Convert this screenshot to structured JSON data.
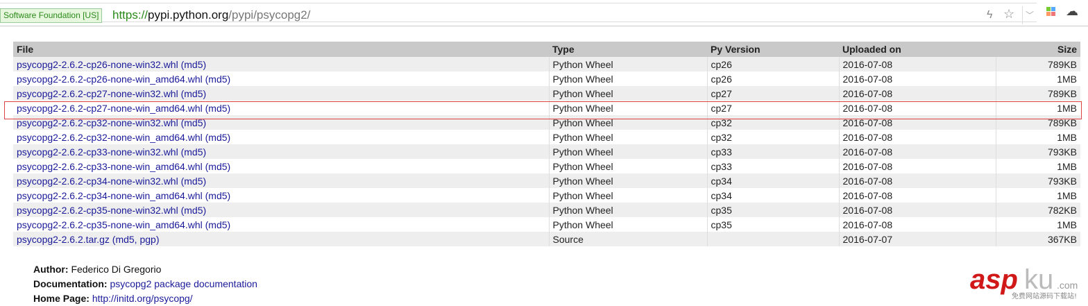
{
  "browser": {
    "cert": "Software Foundation [US]",
    "url_scheme": "https://",
    "url_host": "pypi.python.org",
    "url_path": "/pypi/psycopg2/"
  },
  "table": {
    "headers": [
      "File",
      "Type",
      "Py Version",
      "Uploaded on",
      "Size"
    ],
    "rows": [
      {
        "file": "psycopg2-2.6.2-cp26-none-win32.whl",
        "links": "md5",
        "type": "Python Wheel",
        "py": "cp26",
        "date": "2016-07-08",
        "size": "789KB"
      },
      {
        "file": "psycopg2-2.6.2-cp26-none-win_amd64.whl",
        "links": "md5",
        "type": "Python Wheel",
        "py": "cp26",
        "date": "2016-07-08",
        "size": "1MB"
      },
      {
        "file": "psycopg2-2.6.2-cp27-none-win32.whl",
        "links": "md5",
        "type": "Python Wheel",
        "py": "cp27",
        "date": "2016-07-08",
        "size": "789KB"
      },
      {
        "file": "psycopg2-2.6.2-cp27-none-win_amd64.whl",
        "links": "md5",
        "type": "Python Wheel",
        "py": "cp27",
        "date": "2016-07-08",
        "size": "1MB"
      },
      {
        "file": "psycopg2-2.6.2-cp32-none-win32.whl",
        "links": "md5",
        "type": "Python Wheel",
        "py": "cp32",
        "date": "2016-07-08",
        "size": "789KB"
      },
      {
        "file": "psycopg2-2.6.2-cp32-none-win_amd64.whl",
        "links": "md5",
        "type": "Python Wheel",
        "py": "cp32",
        "date": "2016-07-08",
        "size": "1MB"
      },
      {
        "file": "psycopg2-2.6.2-cp33-none-win32.whl",
        "links": "md5",
        "type": "Python Wheel",
        "py": "cp33",
        "date": "2016-07-08",
        "size": "793KB"
      },
      {
        "file": "psycopg2-2.6.2-cp33-none-win_amd64.whl",
        "links": "md5",
        "type": "Python Wheel",
        "py": "cp33",
        "date": "2016-07-08",
        "size": "1MB"
      },
      {
        "file": "psycopg2-2.6.2-cp34-none-win32.whl",
        "links": "md5",
        "type": "Python Wheel",
        "py": "cp34",
        "date": "2016-07-08",
        "size": "793KB"
      },
      {
        "file": "psycopg2-2.6.2-cp34-none-win_amd64.whl",
        "links": "md5",
        "type": "Python Wheel",
        "py": "cp34",
        "date": "2016-07-08",
        "size": "1MB"
      },
      {
        "file": "psycopg2-2.6.2-cp35-none-win32.whl",
        "links": "md5",
        "type": "Python Wheel",
        "py": "cp35",
        "date": "2016-07-08",
        "size": "782KB"
      },
      {
        "file": "psycopg2-2.6.2-cp35-none-win_amd64.whl",
        "links": "md5",
        "type": "Python Wheel",
        "py": "cp35",
        "date": "2016-07-08",
        "size": "1MB"
      },
      {
        "file": "psycopg2-2.6.2.tar.gz",
        "links": "md5, pgp",
        "type": "Source",
        "py": "",
        "date": "2016-07-07",
        "size": "367KB"
      }
    ]
  },
  "meta": {
    "author_label": "Author:",
    "author": "Federico Di Gregorio",
    "doc_label": "Documentation:",
    "doc": "psycopg2 package documentation",
    "home_label": "Home Page:",
    "home": "http://initd.org/psycopg/"
  },
  "watermark": {
    "brand": "aspku.com",
    "tagline": "免费网站源码下载站!"
  }
}
